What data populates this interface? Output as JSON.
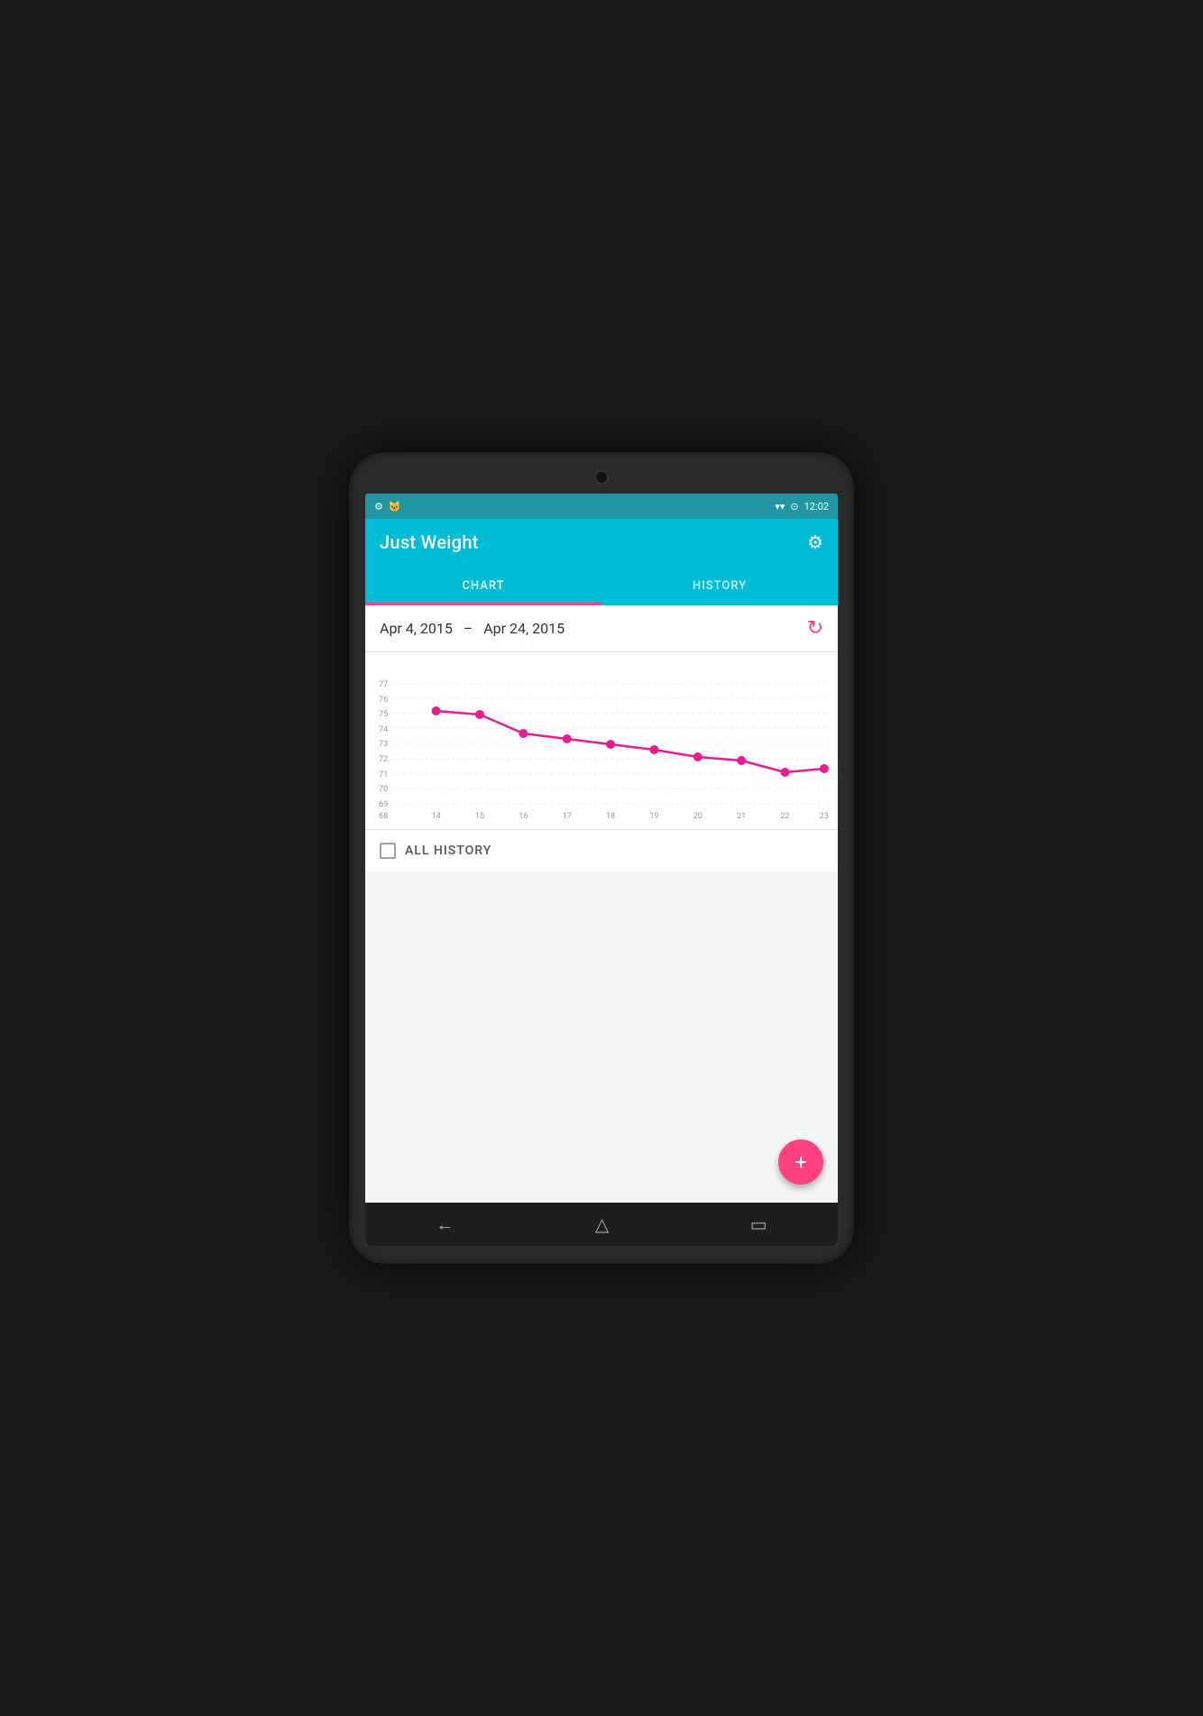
{
  "device": {
    "time": "12:02"
  },
  "app": {
    "title": "Just Weight",
    "settings_icon": "⚙"
  },
  "tabs": [
    {
      "id": "chart",
      "label": "CHART",
      "active": true
    },
    {
      "id": "history",
      "label": "HISTORY",
      "active": false
    }
  ],
  "date_range": {
    "start": "Apr 4, 2015",
    "separator": "–",
    "end": "Apr 24, 2015"
  },
  "chart": {
    "y_min": 68,
    "y_max": 77,
    "x_labels": [
      "14",
      "15",
      "16",
      "17",
      "18",
      "19",
      "20",
      "21",
      "22",
      "23"
    ],
    "data_points": [
      {
        "x": 14,
        "y": 75.0
      },
      {
        "x": 15,
        "y": 74.7
      },
      {
        "x": 16,
        "y": 73.3
      },
      {
        "x": 17,
        "y": 72.9
      },
      {
        "x": 18,
        "y": 72.5
      },
      {
        "x": 19,
        "y": 72.1
      },
      {
        "x": 20,
        "y": 71.5
      },
      {
        "x": 21,
        "y": 71.3
      },
      {
        "x": 22,
        "y": 70.4
      },
      {
        "x": 23,
        "y": 70.7
      }
    ],
    "line_color": "#e91e8c",
    "dot_color": "#e91e8c"
  },
  "all_history": {
    "label": "ALL HISTORY",
    "checked": false
  },
  "fab": {
    "label": "+"
  },
  "nav": {
    "back_icon": "←",
    "home_icon": "△",
    "recents_icon": "▭"
  }
}
